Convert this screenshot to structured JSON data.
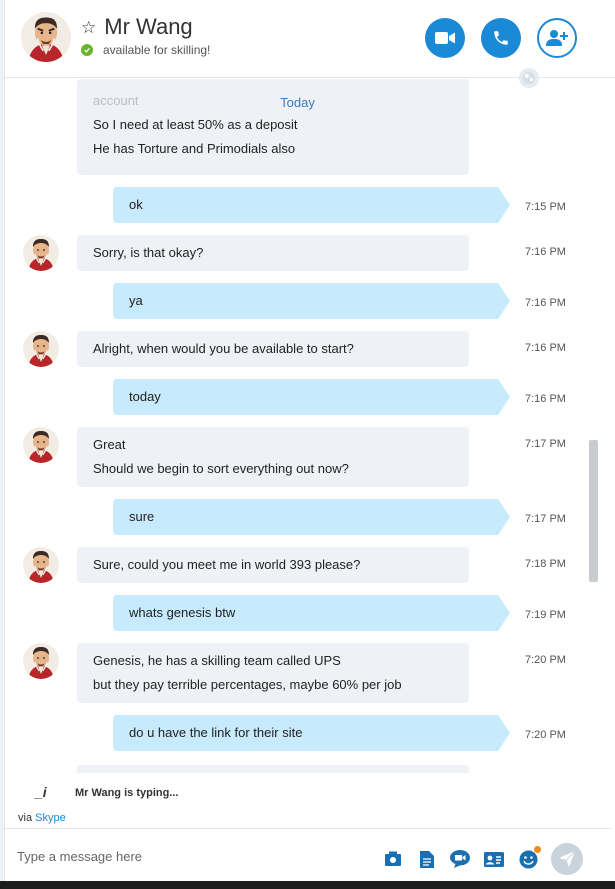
{
  "header": {
    "contact_name": "Mr Wang",
    "status": "available for skilling!",
    "status_color": "#6ab42d",
    "accent_color": "#1a8ad6",
    "buttons": [
      "video-call",
      "audio-call",
      "add-people"
    ]
  },
  "conversation": {
    "date_divider": "Today",
    "cut_off_line": "account",
    "messages": [
      {
        "dir": "in",
        "lines": [
          "So I need at least 50% as a deposit",
          "He has Torture and Primodials also"
        ],
        "time": ""
      },
      {
        "dir": "out",
        "lines": [
          "ok"
        ],
        "time": "7:15 PM"
      },
      {
        "dir": "in",
        "lines": [
          "Sorry, is that okay?"
        ],
        "time": "7:16 PM"
      },
      {
        "dir": "out",
        "lines": [
          "ya"
        ],
        "time": "7:16 PM"
      },
      {
        "dir": "in",
        "lines": [
          "Alright, when would you be available to start?"
        ],
        "time": "7:16 PM"
      },
      {
        "dir": "out",
        "lines": [
          "today"
        ],
        "time": "7:16 PM"
      },
      {
        "dir": "in",
        "lines": [
          "Great",
          "Should we begin to sort everything out now?"
        ],
        "time": "7:17 PM"
      },
      {
        "dir": "out",
        "lines": [
          "sure"
        ],
        "time": "7:17 PM"
      },
      {
        "dir": "in",
        "lines": [
          "Sure, could you meet me in world 393 please?"
        ],
        "time": "7:18 PM"
      },
      {
        "dir": "out",
        "lines": [
          "whats genesis btw"
        ],
        "time": "7:19 PM"
      },
      {
        "dir": "in",
        "lines": [
          "Genesis, he has a skilling team called UPS",
          "but they pay terrible percentages, maybe 60% per job"
        ],
        "time": "7:20 PM"
      },
      {
        "dir": "out",
        "lines": [
          "do u have the link for their site"
        ],
        "time": "7:20 PM"
      }
    ]
  },
  "typing": {
    "indicator": "_i",
    "text": "Mr Wang is typing..."
  },
  "via": {
    "prefix": "via",
    "link": "Skype"
  },
  "composer": {
    "placeholder": "Type a message here",
    "icons": [
      "media-icon",
      "file-icon",
      "video-message-icon",
      "contact-card-icon",
      "emoticon-icon",
      "send-icon"
    ]
  }
}
